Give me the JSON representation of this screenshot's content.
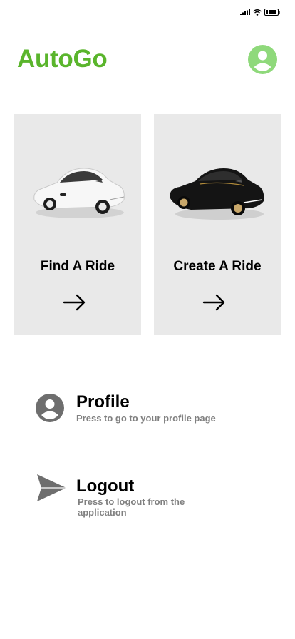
{
  "app": {
    "title": "AutoGo"
  },
  "cards": [
    {
      "label": "Find A Ride",
      "car_color": "white"
    },
    {
      "label": "Create A Ride",
      "car_color": "black"
    }
  ],
  "menu": {
    "profile": {
      "title": "Profile",
      "description": "Press to go to your profile page"
    },
    "logout": {
      "title": "Logout",
      "description": "Press to logout from the application"
    }
  },
  "colors": {
    "brand": "#5ab52c",
    "avatar": "#8fd97b",
    "card_bg": "#e9e9e9",
    "muted": "#808080"
  },
  "icons": {
    "status": [
      "signal-icon",
      "wifi-icon",
      "battery-icon"
    ],
    "avatar": "user-avatar-icon",
    "card_arrow": "arrow-right-icon",
    "profile": "profile-icon",
    "logout": "send-icon"
  }
}
